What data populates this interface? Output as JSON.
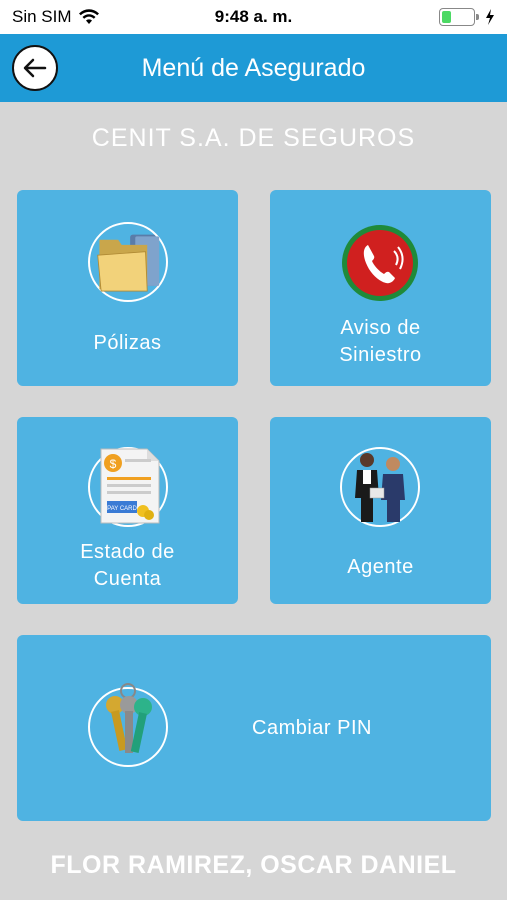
{
  "status_bar": {
    "carrier": "Sin SIM",
    "time": "9:48 a. m.",
    "battery_level": 0.3,
    "icons": [
      "wifi-icon",
      "battery-icon",
      "charging-bolt-icon"
    ]
  },
  "nav": {
    "title": "Menú de Asegurado",
    "back_icon": "arrow-left-icon"
  },
  "company": "CENIT S.A. DE SEGUROS",
  "tiles": [
    {
      "id": "polizas",
      "label": "Pólizas",
      "icon": "folder-icon"
    },
    {
      "id": "siniestro",
      "label": "Aviso de Siniestro",
      "line1": "Aviso de",
      "line2": "Siniestro",
      "icon": "phone-icon"
    },
    {
      "id": "estado",
      "label": "Estado de Cuenta",
      "line1": "Estado de",
      "line2": "Cuenta",
      "icon": "pay-card-icon",
      "icon_text": "PAY CARD"
    },
    {
      "id": "agente",
      "label": "Agente",
      "icon": "agent-people-icon"
    },
    {
      "id": "pin",
      "label": "Cambiar PIN",
      "icon": "keys-icon"
    }
  ],
  "user_name": "FLOR RAMIREZ, OSCAR DANIEL",
  "colors": {
    "nav": "#1e9ad6",
    "tile": "#4fb3e2",
    "background": "#d6d6d6",
    "battery": "#4cd964",
    "phone_circle": "#d0201f"
  }
}
